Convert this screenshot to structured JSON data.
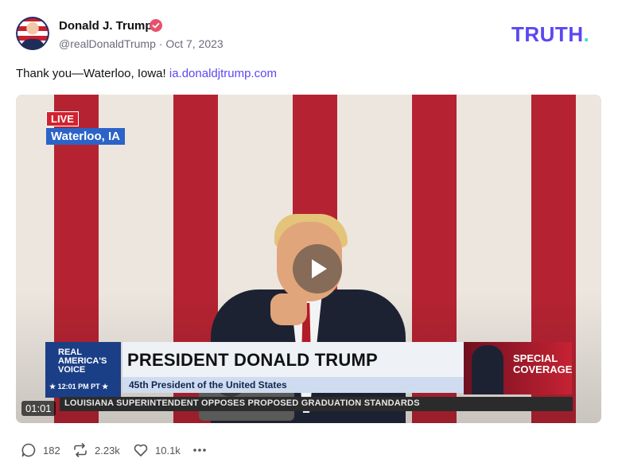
{
  "author": {
    "name": "Donald J. Trump",
    "handle": "@realDonaldTrump",
    "date": "Oct 7, 2023",
    "verified_icon": "verified-badge-icon"
  },
  "brand": {
    "logo_text": "TRUTH",
    "logo_dot": ".",
    "accent_color": "#5b47f2",
    "dot_color": "#2ee6c4"
  },
  "post": {
    "text": "Thank you—Waterloo, Iowa!",
    "link_text": "ia.donaldjtrump.com"
  },
  "video": {
    "live_label": "LIVE",
    "location": "Waterloo, IA",
    "network_line1": "REAL",
    "network_line2": "AMERICA'S",
    "network_line3": "VOICE",
    "network_time": "★ 12:01 PM PT ★",
    "headline": "PRESIDENT DONALD TRUMP",
    "subheadline": "45th President of the United States",
    "special_line1": "SPECIAL",
    "special_line2": "COVERAGE",
    "ticker": "LOUISIANA SUPERINTENDENT OPPOSES PROPOSED GRADUATION STANDARDS",
    "duration": "01:01",
    "play_icon": "play-icon"
  },
  "actions": {
    "replies": "182",
    "retruths": "2.23k",
    "likes": "10.1k",
    "icons": [
      "reply-icon",
      "retruth-icon",
      "heart-icon",
      "more-icon"
    ]
  }
}
